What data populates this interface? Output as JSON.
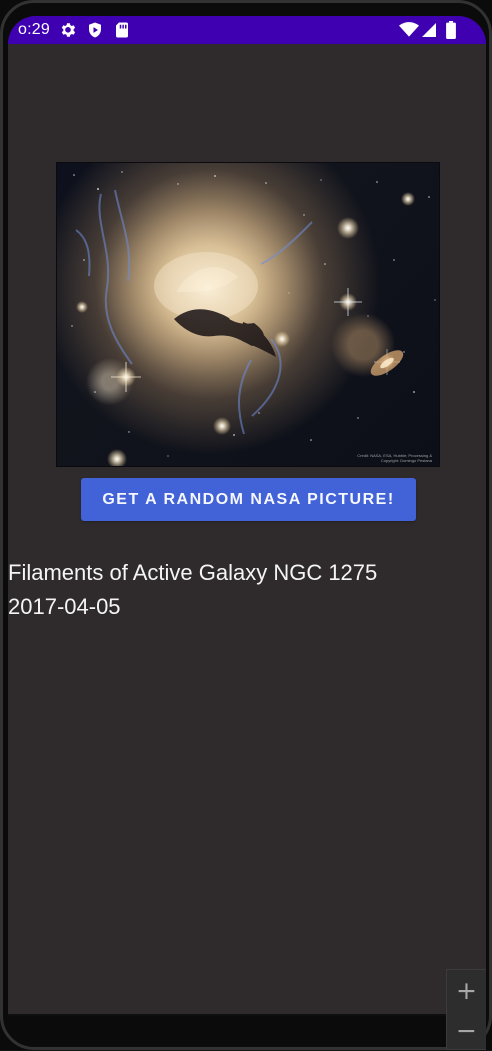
{
  "status_bar": {
    "time": "o:29",
    "icons": [
      "gear-icon",
      "shield-icon",
      "sd-card-icon",
      "wifi-icon",
      "signal-icon",
      "battery-icon"
    ]
  },
  "main": {
    "image_alt": "Filaments of Active Galaxy NGC 1275",
    "image_credit": "Credit: NASA, ESA, Hubble; Processing & Copyright: Domingo Pestana",
    "button_label": "GET A RANDOM NASA PICTURE!",
    "title": "Filaments of Active Galaxy NGC 1275",
    "date": "2017-04-05"
  },
  "zoom_controls": {
    "zoom_in_label": "+",
    "zoom_out_label": "−"
  },
  "colors": {
    "status_bar": "#3f00b2",
    "screen_background": "#2f2b2d",
    "button_background": "#4262d7",
    "text": "#f5f5f5"
  }
}
